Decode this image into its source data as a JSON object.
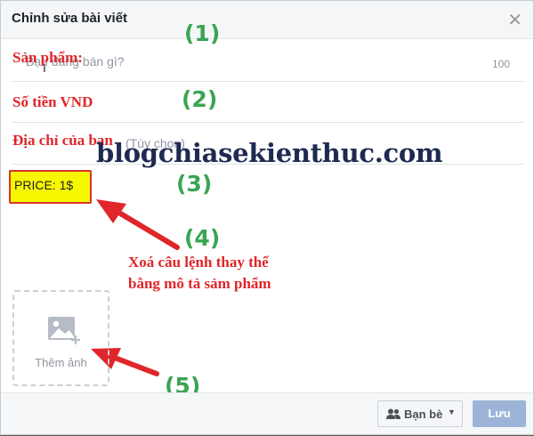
{
  "dialog": {
    "title": "Chỉnh sửa bài viết"
  },
  "fields": {
    "product": {
      "overlay_label": "Sản phẩm:",
      "placeholder": "Bạn đang bán gì?",
      "char_count": "100"
    },
    "price": {
      "overlay_label": "Số tiền VND"
    },
    "location": {
      "overlay_label": "Địa chỉ của bạn",
      "placeholder_hint": "(Tùy chọn)"
    }
  },
  "description": {
    "value": "PRICE: 1$"
  },
  "watermark": "blogchiasekienthuc.com",
  "annotations": {
    "step1": "(1)",
    "step2": "(2)",
    "step3": "(3)",
    "step4": "(4)",
    "step5": "(5)",
    "note": [
      "Xoá câu lệnh thay thế",
      "bằng mô tả sảm phẩm"
    ]
  },
  "photo": {
    "label": "Thêm ảnh"
  },
  "footer": {
    "audience_label": "Bạn bè",
    "save_label": "Lưu"
  },
  "colors": {
    "annotation_red": "#e0262a",
    "step_green": "#3aa553",
    "highlight_yellow": "#f7f700",
    "save_blue": "#9cb4d8"
  }
}
